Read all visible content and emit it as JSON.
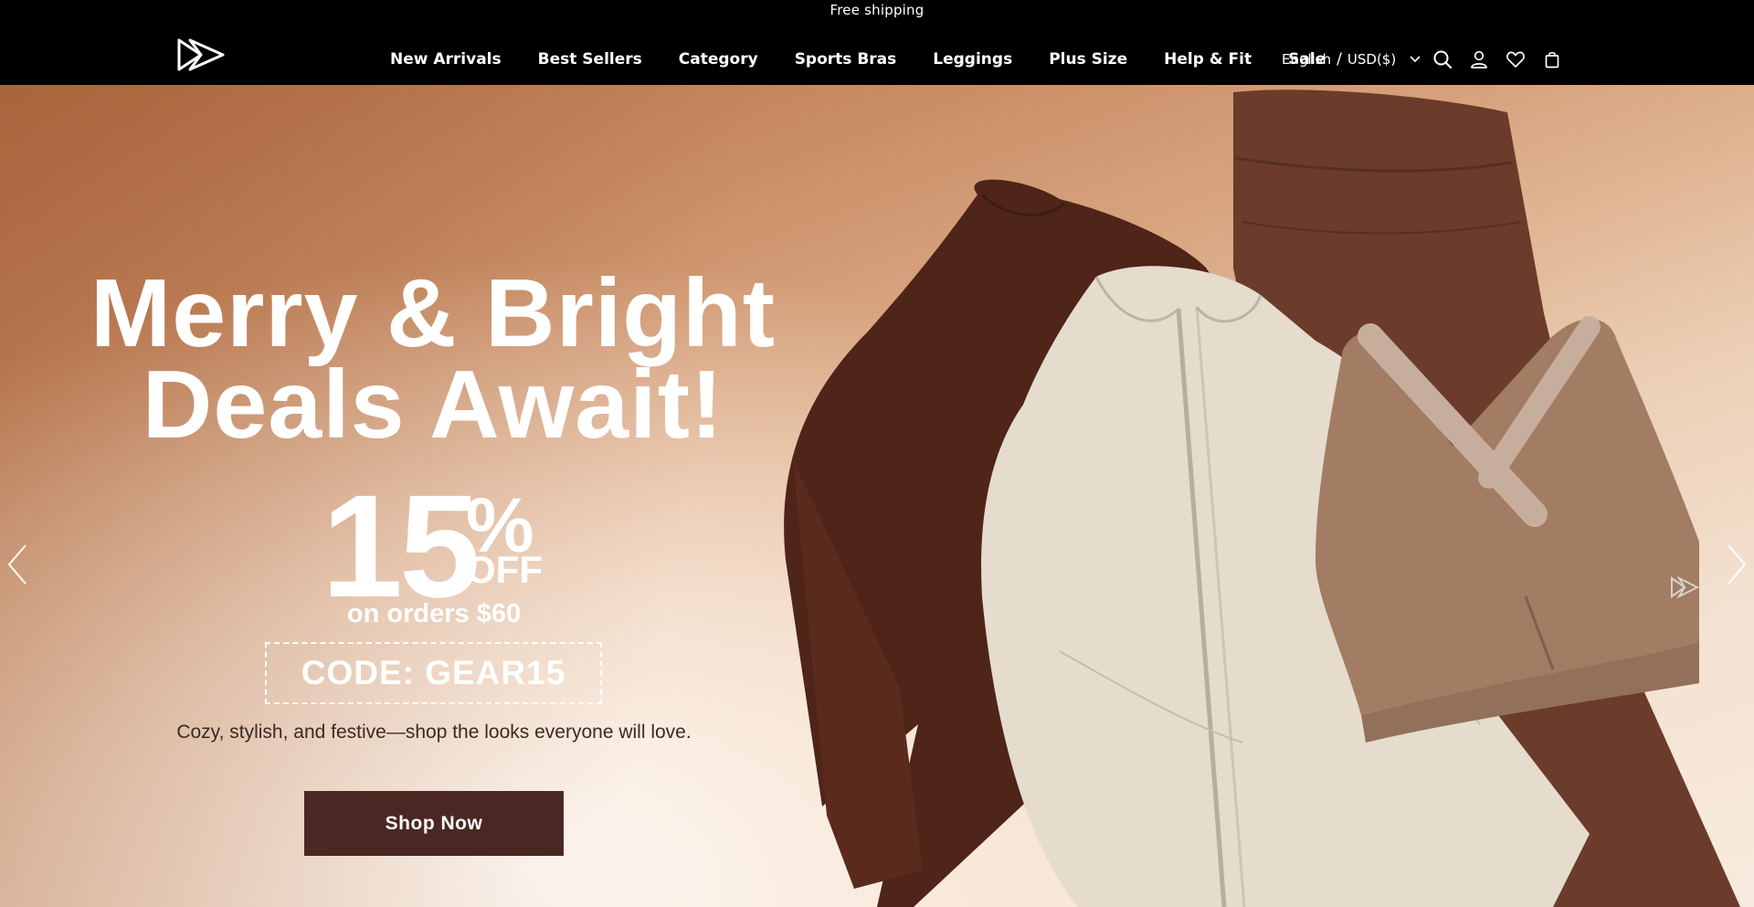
{
  "announcement": "Free shipping",
  "nav": {
    "items": [
      {
        "label": "New Arrivals"
      },
      {
        "label": "Best Sellers"
      },
      {
        "label": "Category"
      },
      {
        "label": "Sports Bras"
      },
      {
        "label": "Leggings"
      },
      {
        "label": "Plus Size"
      },
      {
        "label": "Help & Fit"
      },
      {
        "label": "Sale"
      }
    ]
  },
  "locale": {
    "language": "English",
    "separator": "/",
    "currency": "USD($)"
  },
  "header_icons": [
    "search-icon",
    "account-icon",
    "wishlist-heart-icon",
    "cart-bag-icon"
  ],
  "hero": {
    "headline_line1": "Merry & Bright",
    "headline_line2": "Deals Await!",
    "discount_number": "15",
    "discount_percent": "%",
    "discount_off": "OFF",
    "min_order": "on orders $60",
    "promo_code": "CODE: GEAR15",
    "tagline": "Cozy, stylish, and festive—shop the looks everyone will love.",
    "cta_label": "Shop Now"
  },
  "colors": {
    "header_bg": "#000000",
    "cta_bg": "#4a2722",
    "text_light": "#ffffff",
    "tagline_text": "#3b2a22"
  }
}
